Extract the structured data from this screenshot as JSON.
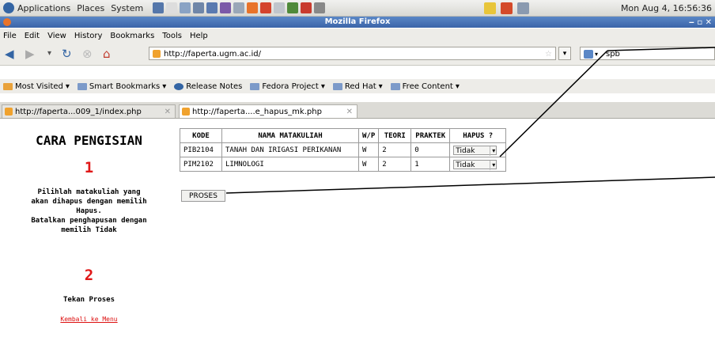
{
  "desktop_panel": {
    "menus": [
      "Applications",
      "Places",
      "System"
    ],
    "clock": "Mon Aug  4, 16:56:36"
  },
  "window": {
    "title": "Mozilla Firefox"
  },
  "menubar": [
    "File",
    "Edit",
    "View",
    "History",
    "Bookmarks",
    "Tools",
    "Help"
  ],
  "navbar": {
    "url": "http://faperta.ugm.ac.id/",
    "search_value": "spb"
  },
  "bookmarks": [
    "Most Visited",
    "Smart Bookmarks",
    "Release Notes",
    "Fedora Project",
    "Red Hat",
    "Free Content"
  ],
  "tabs": [
    {
      "label": "http://faperta...009_1/index.php"
    },
    {
      "label": "http://faperta....e_hapus_mk.php"
    }
  ],
  "instructions": {
    "title": "CARA PENGISIAN",
    "step1_number": "1",
    "step1_line1": "Pilihlah matakuliah yang",
    "step1_line2": "akan dihapus dengan memilih",
    "step1_line3": "Hapus.",
    "step1_line4": "Batalkan penghapusan dengan",
    "step1_line5": "memilih Tidak",
    "step2_number": "2",
    "step2_text": "Tekan Proses",
    "back_link": "Kembali ke Menu"
  },
  "table": {
    "headers": [
      "KODE",
      "NAMA MATAKULIAH",
      "W/P",
      "TEORI",
      "PRAKTEK",
      "HAPUS ?"
    ],
    "rows": [
      {
        "kode": "PIB2104",
        "nama": "TANAH DAN IRIGASI PERIKANAN",
        "wp": "W",
        "teori": "2",
        "praktek": "0",
        "hapus": "Tidak"
      },
      {
        "kode": "PIM2102",
        "nama": "LIMNOLOGI",
        "wp": "W",
        "teori": "2",
        "praktek": "1",
        "hapus": "Tidak"
      }
    ]
  },
  "proses_label": "PROSES"
}
